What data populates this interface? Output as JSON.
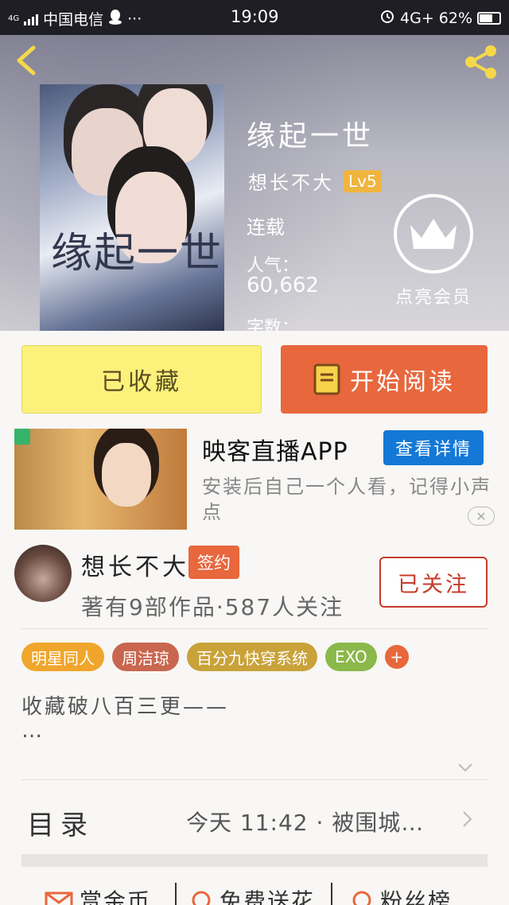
{
  "status_bar": {
    "network_small": "4G",
    "carrier": "中国电信",
    "dots": "···",
    "time": "19:09",
    "network": "4G+",
    "battery_percent": "62%"
  },
  "book": {
    "cover_title": "缘起一世",
    "title": "缘起一世",
    "author": "想长不大",
    "level": "Lv5",
    "status": "连载",
    "popularity_label": "人气：",
    "popularity_value": "60,662",
    "word_count_label": "字数：",
    "vip_label": "点亮会员"
  },
  "actions": {
    "collected_label": "已收藏",
    "read_label": "开始阅读"
  },
  "ad": {
    "title": "映客直播APP",
    "button_label": "查看详情",
    "description": "安装后自己一个人看，记得小声点",
    "close_label": "✕"
  },
  "author_info": {
    "name": "想长不大",
    "sign_badge": "签约",
    "stats": "著有9部作品·587人关注",
    "follow_label": "已关注"
  },
  "tags": [
    {
      "label": "明星同人",
      "color": "#f0a62c"
    },
    {
      "label": "周洁琼",
      "color": "#c9664f"
    },
    {
      "label": "百分九快穿系统",
      "color": "#c9a23a"
    },
    {
      "label": "EXO",
      "color": "#8bb84a"
    }
  ],
  "tag_add_label": "+",
  "intro": {
    "line1": "收藏破八百三更——",
    "line2": "…"
  },
  "toc": {
    "label": "目录",
    "latest": "今天 11:42 · 被围城…"
  },
  "bottom": {
    "reward": "赏金币",
    "flower": "免费送花",
    "fans": "粉丝榜"
  },
  "colors": {
    "accent_orange": "#e8673d",
    "collected_yellow": "#fbf17b",
    "ad_blue": "#1478d6",
    "follow_red": "#c63b2a",
    "level_gold": "#f0b53f"
  }
}
